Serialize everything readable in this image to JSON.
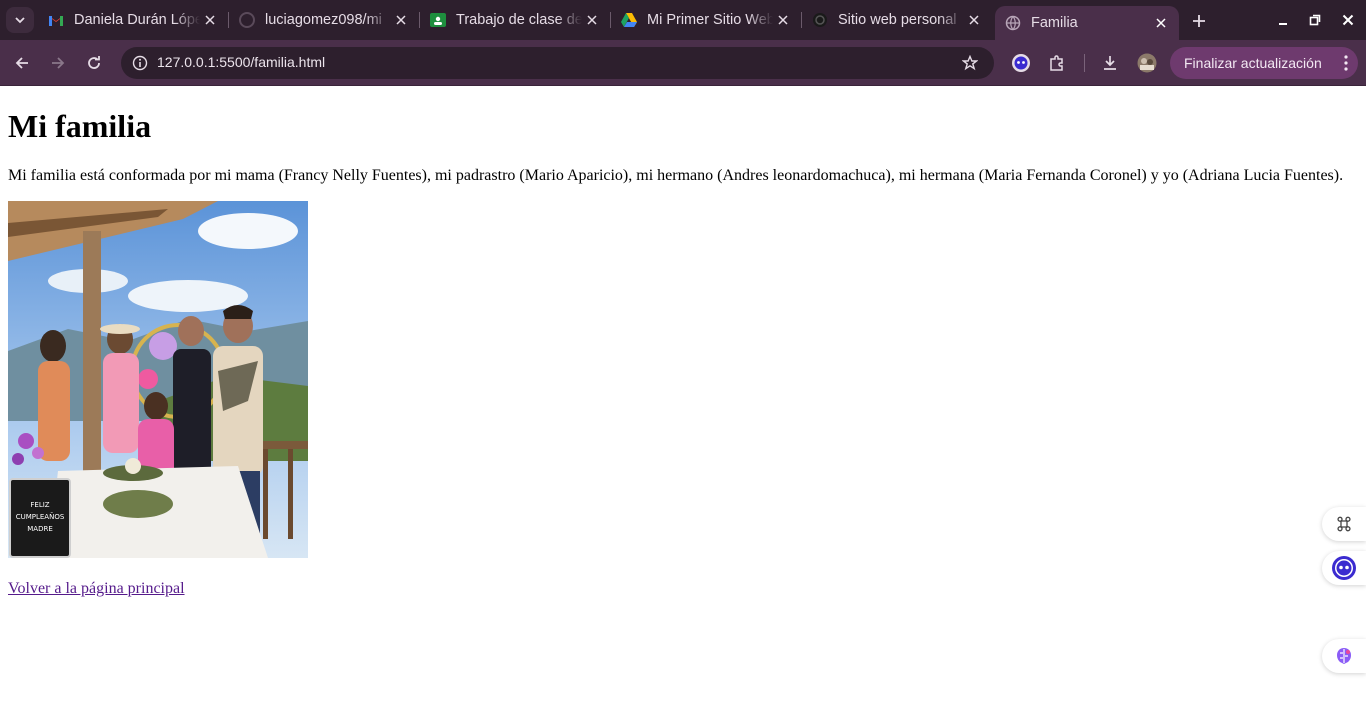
{
  "browser": {
    "tabs": [
      {
        "title": "Daniela Durán López",
        "icon": "gmail-icon"
      },
      {
        "title": "luciagomez098/mi",
        "icon": "github-icon"
      },
      {
        "title": "Trabajo de clase de",
        "icon": "classroom-icon"
      },
      {
        "title": "Mi Primer Sitio Web",
        "icon": "drive-icon"
      },
      {
        "title": "Sitio web personal",
        "icon": "openai-icon"
      },
      {
        "title": "Familia",
        "icon": "globe-icon",
        "active": true
      }
    ],
    "url": "127.0.0.1:5500/familia.html",
    "update_button": "Finalizar actualización",
    "colors": {
      "frame": "#2d1f2d",
      "toolbar": "#4a2f4a",
      "update": "#6e3a6e"
    }
  },
  "page": {
    "heading": "Mi familia",
    "description": "Mi familia está conformada por mi mama (Francy Nelly Fuentes), mi padrastro (Mario Aparicio), mi hermano (Andres leonardomachuca), mi hermana (Maria Fernanda Coronel) y yo (Adriana Lucia Fuentes).",
    "photo_sign": [
      "FELIZ",
      "CUMPLEAÑOS",
      "MADRE"
    ],
    "back_link": "Volver a la página principal",
    "link_color": "#551a8b"
  }
}
